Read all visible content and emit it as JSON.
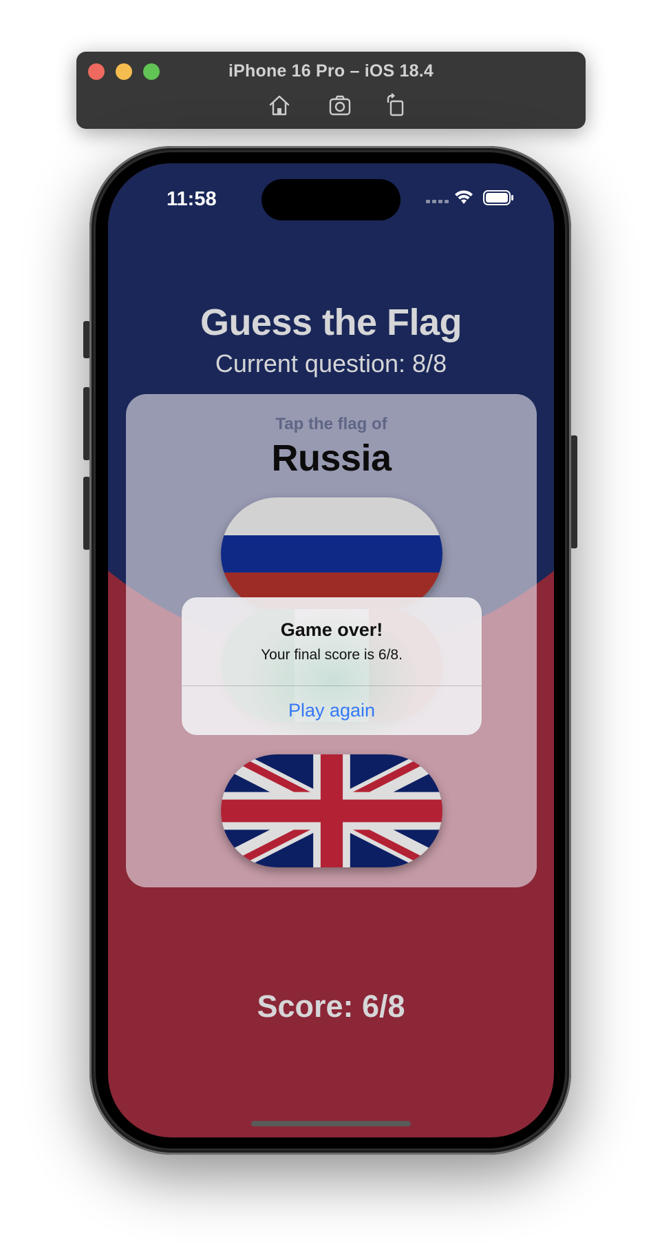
{
  "simulator": {
    "title": "iPhone 16 Pro – iOS 18.4",
    "toolbar_icons": [
      "home-icon",
      "screenshot-icon",
      "rotate-icon"
    ]
  },
  "status_bar": {
    "time": "11:58",
    "icons": [
      "cellular-icon",
      "wifi-icon",
      "battery-icon"
    ]
  },
  "app": {
    "title": "Guess the Flag",
    "current_question": "Current question: 8/8",
    "prompt_label": "Tap the flag of",
    "prompt_country": "Russia",
    "flags": [
      "Russia",
      "Italy",
      "UK"
    ],
    "score": "Score: 6/8"
  },
  "alert": {
    "title": "Game over!",
    "message": "Your final score is 6/8.",
    "button": "Play again"
  },
  "colors": {
    "navy": "#1a2758",
    "crimson": "#8b2737",
    "accent_blue": "#3478f6"
  }
}
